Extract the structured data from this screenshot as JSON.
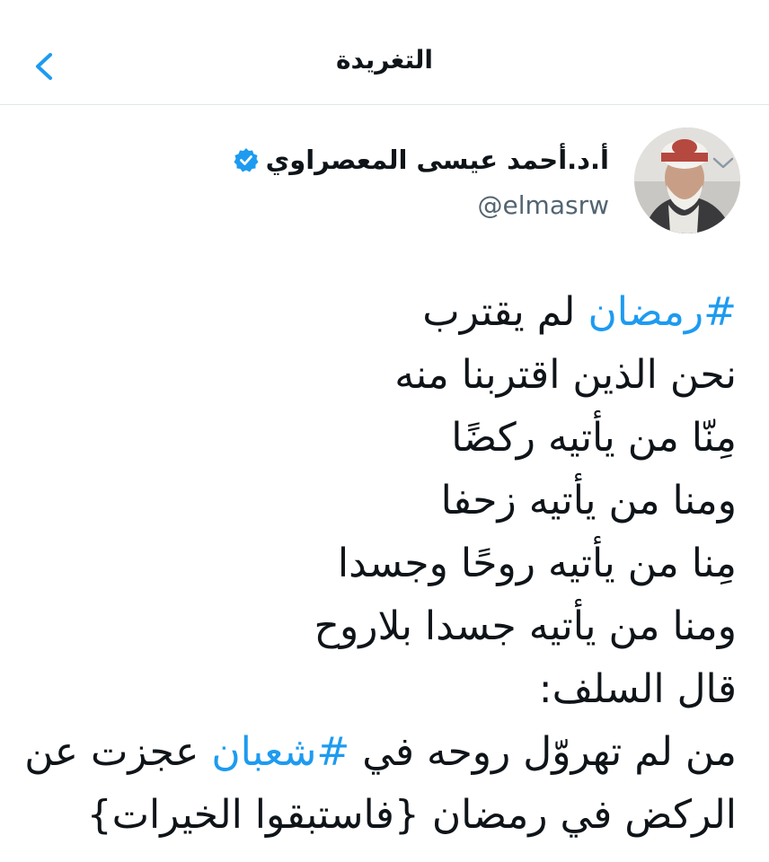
{
  "header": {
    "title": "التغريدة",
    "back_icon": "chevron-left-icon"
  },
  "author": {
    "name": "أ.د.أحمد عيسى المعصراوي",
    "handle": "@elmasrw",
    "verified": true
  },
  "tweet": {
    "lines": [
      {
        "hashtag": "#رمضان",
        "text": " لم يقترب"
      },
      {
        "text": "نحن الذين اقتربنا منه"
      },
      {
        "text": "مِنّا من يأتيه ركضًا"
      },
      {
        "text": "ومنا من يأتيه زحفا"
      },
      {
        "text": "مِنا من يأتيه روحًا وجسدا"
      },
      {
        "text": "ومنا من يأتيه جسدا بلاروح"
      },
      {
        "text": "قال السلف:"
      },
      {
        "before": "من لم تهروّل روحه في ",
        "hashtag": "#شعبان",
        "after": " عجزت عن"
      },
      {
        "text": "الركض في رمضان {فاستبقوا الخيرات}"
      }
    ]
  },
  "colors": {
    "accent": "#1d9bf0",
    "text": "#0f1419",
    "secondary": "#536471",
    "divider": "#e3e6e8"
  }
}
